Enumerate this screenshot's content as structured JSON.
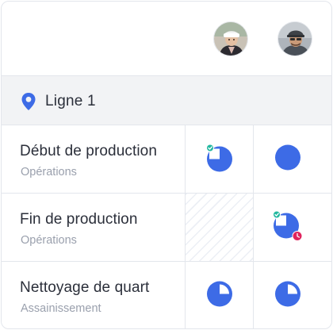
{
  "colors": {
    "accent": "#3d6be6",
    "done": "#23b8a0",
    "late": "#e0245e",
    "border": "#e3e6ec",
    "group_bg": "#f2f3f5"
  },
  "header": {
    "avatars": [
      {
        "icon": "worker-avatar"
      },
      {
        "icon": "worker-avatar"
      }
    ]
  },
  "group": {
    "icon": "location-pin-icon",
    "label": "Ligne 1"
  },
  "tasks": [
    {
      "title": "Début de production",
      "category": "Opérations",
      "cells": [
        {
          "status": "partial-complete",
          "badges": [
            "check"
          ]
        },
        {
          "status": "full"
        }
      ]
    },
    {
      "title": "Fin de production",
      "category": "Opérations",
      "cells": [
        {
          "status": "not-applicable"
        },
        {
          "status": "partial-complete-late",
          "badges": [
            "check",
            "clock"
          ]
        }
      ]
    },
    {
      "title": "Nettoyage de quart",
      "category": "Assainissement",
      "cells": [
        {
          "status": "partial"
        },
        {
          "status": "partial"
        }
      ]
    }
  ]
}
